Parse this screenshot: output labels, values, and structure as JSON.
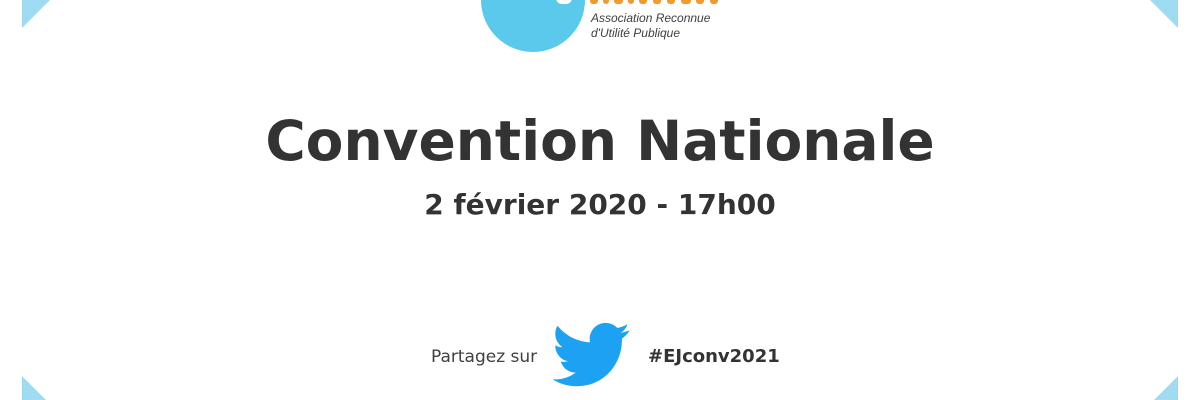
{
  "logo": {
    "association_line1": "Association Reconnue",
    "association_line2": "d'Utilité Publique",
    "circle_color": "#5ac9ec",
    "accent_color": "#f29a2e"
  },
  "event": {
    "title": "Convention Nationale",
    "datetime": "2 février 2020 - 17h00"
  },
  "share": {
    "label": "Partagez sur",
    "network_icon": "twitter-bird-icon",
    "hashtag": "#EJconv2021",
    "icon_color": "#1da1f2"
  },
  "decor": {
    "corner_color": "#9fdcf1"
  }
}
